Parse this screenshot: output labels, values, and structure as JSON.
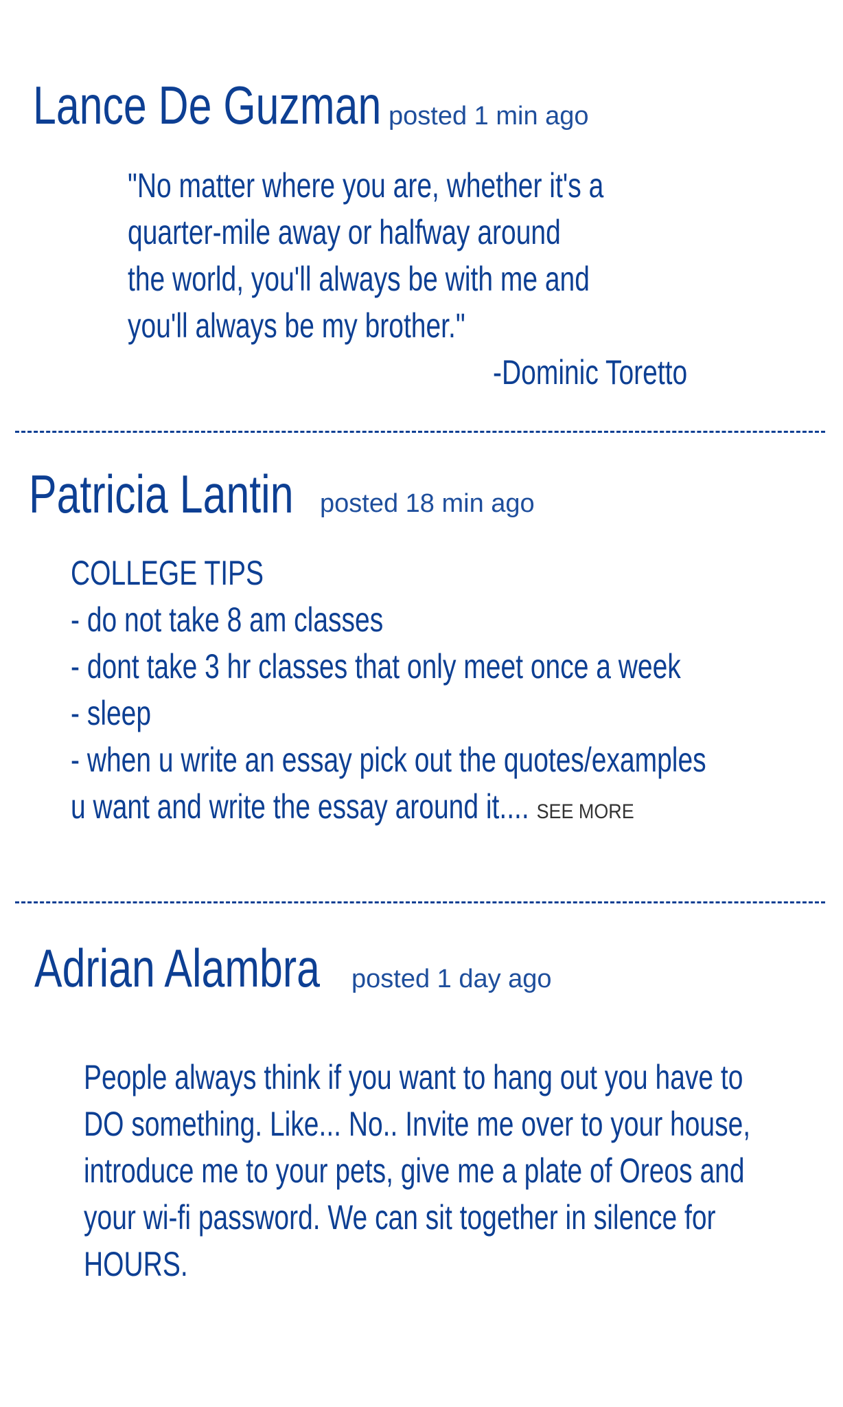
{
  "posts": [
    {
      "author": "Lance De Guzman",
      "posted": "posted 1 min ago",
      "lines": [
        "\"No matter where you are, whether it's a",
        "quarter-mile away or halfway around",
        "the world, you'll always be with me and",
        "you'll always be my brother.\""
      ],
      "attribution": "-Dominic Toretto"
    },
    {
      "author": "Patricia Lantin",
      "posted": "posted 18 min ago",
      "lines": [
        "COLLEGE TIPS",
        "- do  not  take  8 am classes",
        "- dont take 3 hr classes that only meet once a week",
        "- sleep",
        "- when u write an essay pick out the quotes/examples",
        "u want and write the essay around it...."
      ],
      "see_more": "SEE MORE"
    },
    {
      "author": "Adrian Alambra",
      "posted": "posted 1 day ago",
      "lines": [
        "People always think if you want to hang out you have to",
        "DO something. Like... No.. Invite me over to your house,",
        "introduce me to your pets, give me a plate of Oreos and",
        "your wi-fi password. We can sit together in silence for",
        "HOURS."
      ]
    }
  ]
}
